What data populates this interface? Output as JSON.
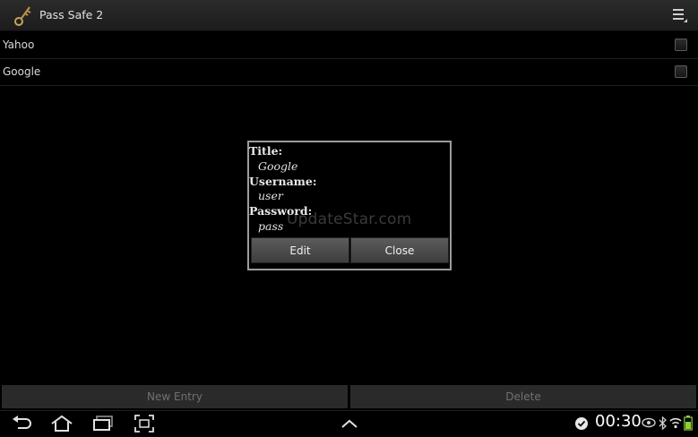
{
  "app": {
    "title": "Pass Safe 2"
  },
  "entries": [
    {
      "label": "Yahoo",
      "checked": false
    },
    {
      "label": "Google",
      "checked": false
    }
  ],
  "dialog": {
    "title_label": "Title:",
    "title_value": "Google",
    "username_label": "Username:",
    "username_value": "user",
    "password_label": "Password:",
    "password_value": "pass",
    "watermark": "UpdateStar.com",
    "edit_label": "Edit",
    "close_label": "Close"
  },
  "bottom_bar": {
    "new_entry_label": "New Entry",
    "delete_label": "Delete"
  },
  "status_bar": {
    "time": "00:30"
  },
  "icons": {
    "app": "key-icon",
    "overflow": "overflow-menu-icon",
    "back": "back-icon",
    "home": "home-icon",
    "recents": "recent-apps-icon",
    "screenshot": "screenshot-icon",
    "up": "chevron-up-icon",
    "notification": "notification-check-icon",
    "eye": "eye-icon",
    "bluetooth": "bluetooth-icon",
    "wifi": "wifi-icon",
    "battery": "battery-icon"
  }
}
